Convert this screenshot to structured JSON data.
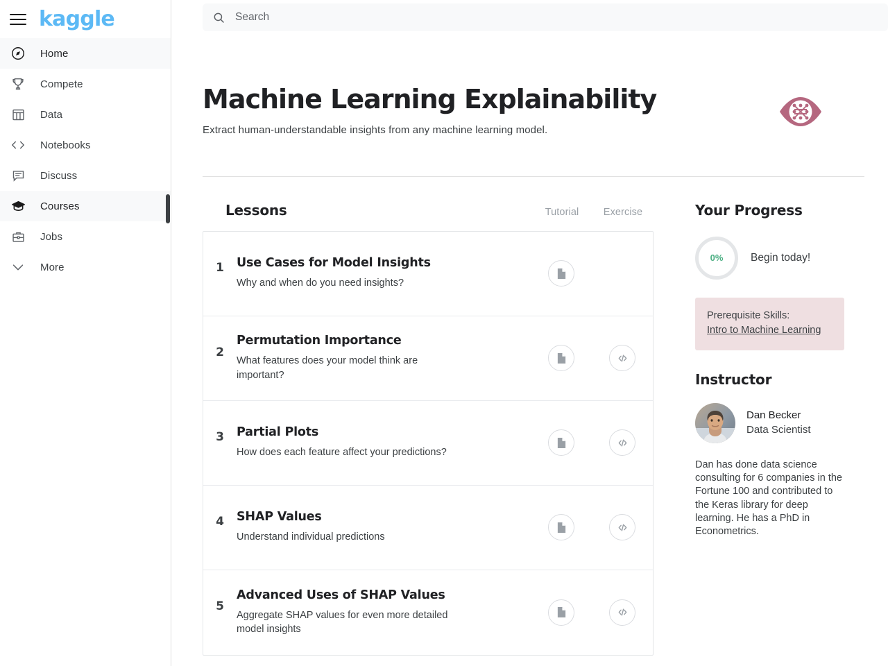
{
  "brand": {
    "logo_text": "kaggle",
    "logo_color": "#5cb9f5",
    "menu_icon": "hamburger-menu-icon"
  },
  "search": {
    "placeholder": "Search",
    "value": "",
    "icon": "search-icon"
  },
  "sidebar": {
    "active_item": "Courses",
    "items": [
      {
        "label": "Home",
        "icon": "compass-icon",
        "active": false
      },
      {
        "label": "Compete",
        "icon": "trophy-icon",
        "active": false
      },
      {
        "label": "Data",
        "icon": "table-icon",
        "active": false
      },
      {
        "label": "Notebooks",
        "icon": "code-brackets-icon",
        "active": false
      },
      {
        "label": "Discuss",
        "icon": "comment-icon",
        "active": false
      },
      {
        "label": "Courses",
        "icon": "graduation-cap-icon",
        "active": true
      },
      {
        "label": "Jobs",
        "icon": "briefcase-icon",
        "active": false
      },
      {
        "label": "More",
        "icon": "chevron-down-icon",
        "active": false
      }
    ]
  },
  "course": {
    "title": "Machine Learning Explainability",
    "subtitle": "Extract human-understandable insights from any machine learning model.",
    "logo_icon": "eye-network-icon",
    "logo_color": "#b5677f"
  },
  "lessons_section": {
    "heading": "Lessons",
    "columns": {
      "tutorial": "Tutorial",
      "exercise": "Exercise"
    },
    "tutorial_icon": "document-icon",
    "exercise_icon": "code-icon",
    "rows": [
      {
        "number": "1",
        "title": "Use Cases for Model Insights",
        "description": "Why and when do you need insights?",
        "has_tutorial": true,
        "has_exercise": false
      },
      {
        "number": "2",
        "title": "Permutation Importance",
        "description": "What features does your model think are important?",
        "has_tutorial": true,
        "has_exercise": true
      },
      {
        "number": "3",
        "title": "Partial Plots",
        "description": "How does each feature affect your predictions?",
        "has_tutorial": true,
        "has_exercise": true
      },
      {
        "number": "4",
        "title": "SHAP Values",
        "description": "Understand individual predictions",
        "has_tutorial": true,
        "has_exercise": true
      },
      {
        "number": "5",
        "title": "Advanced Uses of SHAP Values",
        "description": "Aggregate SHAP values for even more detailed model insights",
        "has_tutorial": true,
        "has_exercise": true
      }
    ]
  },
  "progress": {
    "heading": "Your Progress",
    "percent_label": "0%",
    "percent_value": 0,
    "percent_color": "#4caf83",
    "message": "Begin today!"
  },
  "prerequisites": {
    "label": "Prerequisite Skills:",
    "link_text": "Intro to Machine Learning",
    "background_color": "#efdfe1"
  },
  "instructor": {
    "heading": "Instructor",
    "name": "Dan Becker",
    "role": "Data Scientist",
    "bio": "Dan has done data science consulting for 6 companies in the Fortune 100 and contributed to the Keras library for deep learning. He has a PhD in Econometrics.",
    "avatar_icon": "instructor-avatar"
  }
}
